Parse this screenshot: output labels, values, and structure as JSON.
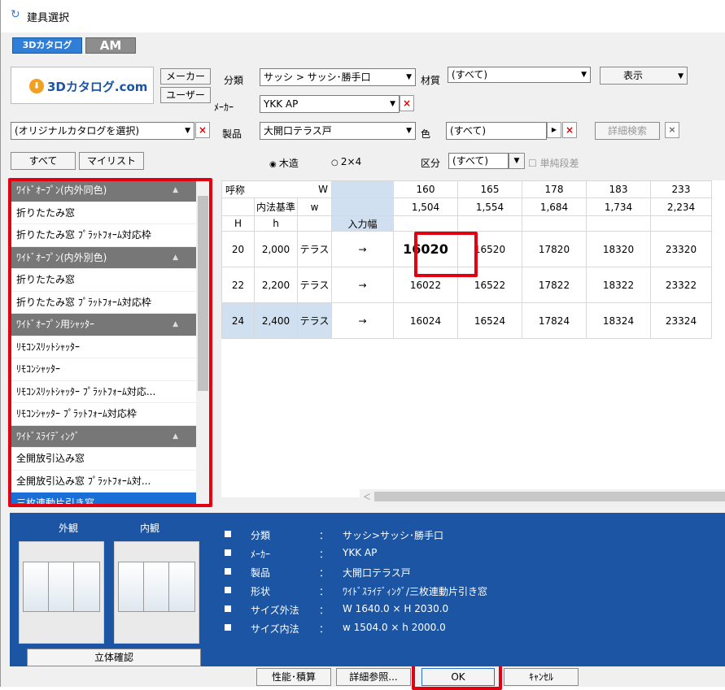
{
  "window": {
    "title": "建具選択"
  },
  "tabs": [
    {
      "label": "3Dカタログ"
    },
    {
      "label": "AM"
    }
  ],
  "logo": {
    "text": "3Dカタログ.com"
  },
  "buttons": {
    "maker": "メーカー",
    "user": "ユーザー",
    "all": "すべて",
    "mylist": "マイリスト",
    "display": "表示",
    "detail_search": "詳細検索",
    "stereo_check": "立体確認",
    "performance": "性能･積算",
    "detail_ref": "詳細参照...",
    "ok": "OK",
    "cancel": "ｷｬﾝｾﾙ"
  },
  "filters": {
    "category_label": "分類",
    "category_value": "サッシ > サッシ･勝手口",
    "material_label": "材質",
    "material_value": "(すべて)",
    "maker_label": "ﾒｰｶｰ",
    "maker_value": "YKK AP",
    "catalog_value": "(オリジナルカタログを選択)",
    "product_label": "製品",
    "product_value": "大開口テラス戸",
    "color_label": "色",
    "color_value": "(すべて)",
    "structure_wood": "木造",
    "structure_2x4": "2×4",
    "division_label": "区分",
    "division_value": "(すべて)",
    "single_step": "単純段差"
  },
  "list_items": [
    {
      "label": "ﾜｲﾄﾞｵｰﾌﾟﾝ(内外同色)",
      "type": "header"
    },
    {
      "label": "折りたたみ窓",
      "type": "item"
    },
    {
      "label": "折りたたみ窓 ﾌﾟﾗｯﾄﾌｫｰﾑ対応枠",
      "type": "item"
    },
    {
      "label": "ﾜｲﾄﾞｵｰﾌﾟﾝ(内外別色)",
      "type": "header"
    },
    {
      "label": "折りたたみ窓",
      "type": "item"
    },
    {
      "label": "折りたたみ窓 ﾌﾟﾗｯﾄﾌｫｰﾑ対応枠",
      "type": "item"
    },
    {
      "label": "ﾜｲﾄﾞｵｰﾌﾟﾝ用ｼｬｯﾀｰ",
      "type": "header"
    },
    {
      "label": "ﾘﾓｺﾝｽﾘｯﾄｼｬｯﾀｰ",
      "type": "item"
    },
    {
      "label": "ﾘﾓｺﾝｼｬｯﾀｰ",
      "type": "item"
    },
    {
      "label": "ﾘﾓｺﾝｽﾘｯﾄｼｬｯﾀｰ ﾌﾟﾗｯﾄﾌｫｰﾑ対応...",
      "type": "item"
    },
    {
      "label": "ﾘﾓｺﾝｼｬｯﾀｰ ﾌﾟﾗｯﾄﾌｫｰﾑ対応枠",
      "type": "item"
    },
    {
      "label": "ﾜｲﾄﾞｽﾗｲﾃﾞｨﾝｸﾞ",
      "type": "header"
    },
    {
      "label": "全開放引込み窓",
      "type": "item"
    },
    {
      "label": "全開放引込み窓 ﾌﾟﾗｯﾄﾌｫｰﾑ対...",
      "type": "item"
    },
    {
      "label": "三枚連動片引き窓",
      "type": "selected"
    }
  ],
  "grid": {
    "h_label": "呼称",
    "w_label": "W",
    "inner_label": "内法基準",
    "w_small": "w",
    "H_label": "H",
    "h_small": "h",
    "input_width": "入力幅",
    "columns": [
      "160",
      "165",
      "178",
      "183",
      "233"
    ],
    "inner_widths": [
      "1,504",
      "1,554",
      "1,684",
      "1,734",
      "2,234"
    ],
    "rows": [
      {
        "H": "20",
        "h": "2,000",
        "type": "テラス",
        "arrow": "→",
        "cells": [
          "16020",
          "16520",
          "17820",
          "18320",
          "23320"
        ]
      },
      {
        "H": "22",
        "h": "2,200",
        "type": "テラス",
        "arrow": "→",
        "cells": [
          "16022",
          "16522",
          "17822",
          "18322",
          "23322"
        ]
      },
      {
        "H": "24",
        "h": "2,400",
        "type": "テラス",
        "arrow": "→",
        "cells": [
          "16024",
          "16524",
          "17824",
          "18324",
          "23324"
        ]
      }
    ]
  },
  "preview": {
    "exterior": "外観",
    "interior": "内観"
  },
  "info": [
    {
      "label": "分類",
      "value": "サッシ>サッシ･勝手口"
    },
    {
      "label": "ﾒｰｶｰ",
      "value": "YKK AP"
    },
    {
      "label": "製品",
      "value": "大開口テラス戸"
    },
    {
      "label": "形状",
      "value": "ﾜｲﾄﾞｽﾗｲﾃﾞｨﾝｸﾞ/三枚連動片引き窓"
    },
    {
      "label": "サイズ外法",
      "value": "W 1640.0 × H 2030.0"
    },
    {
      "label": "サイズ内法",
      "value": "w 1504.0 × h 2000.0"
    }
  ],
  "info_sep": "：",
  "icons": {
    "close": "×",
    "dropdown": "▼",
    "arrow_right": "▶",
    "scroll_left": "＜"
  }
}
